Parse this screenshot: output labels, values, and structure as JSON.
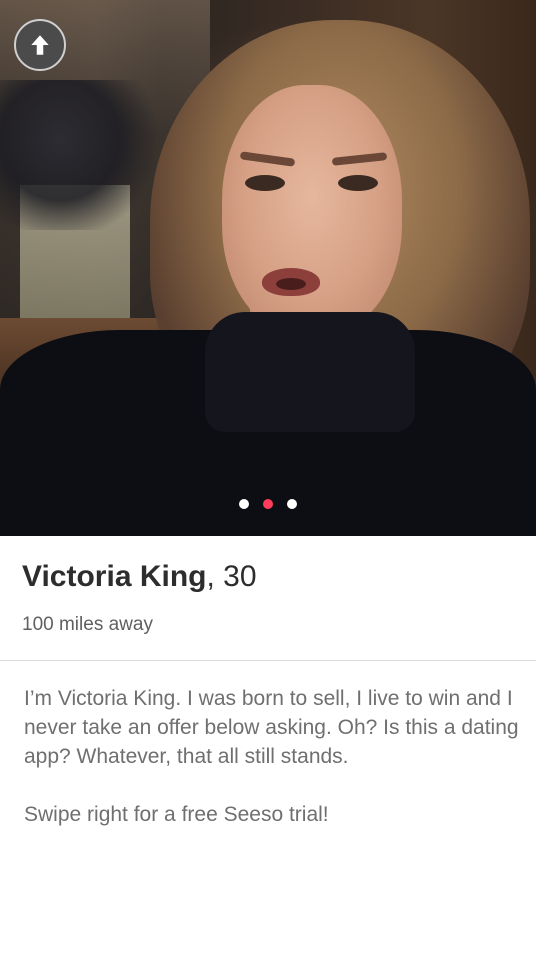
{
  "profile": {
    "name": "Victoria King",
    "age_text": ", 30",
    "distance": "100 miles away",
    "bio_paragraph_1": "I’m Victoria King. I was born to sell, I live to win and I never take an offer below asking. Oh? Is this a dating app? Whatever, that all still stands.",
    "bio_paragraph_2": "Swipe right for a free Seeso trial!"
  },
  "photo_carousel": {
    "photo_count": 3,
    "active_index": 1,
    "active_dot_color": "#fd3d5a",
    "inactive_dot_color": "#ffffff"
  },
  "icons": {
    "back_button": "arrow-up-icon"
  }
}
